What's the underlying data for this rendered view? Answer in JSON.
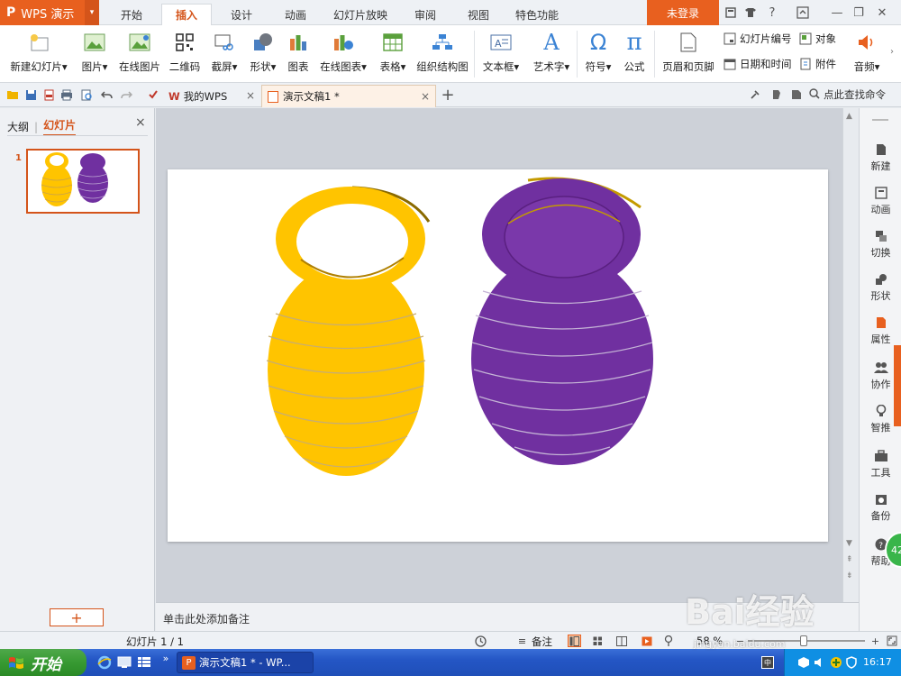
{
  "app": {
    "logo": "P",
    "name": "WPS 演示",
    "menu_arrow": "▾"
  },
  "ribbon_tabs": [
    {
      "label": "开始"
    },
    {
      "label": "插入"
    },
    {
      "label": "设计"
    },
    {
      "label": "动画"
    },
    {
      "label": "幻灯片放映"
    },
    {
      "label": "审阅"
    },
    {
      "label": "视图"
    },
    {
      "label": "特色功能"
    }
  ],
  "login": "未登录",
  "title_icons": {
    "help": "?",
    "minimize": "—",
    "restore": "❐",
    "close": "✕"
  },
  "ribbon": {
    "new_slide": "新建幻灯片",
    "picture": "图片",
    "online_picture": "在线图片",
    "qrcode": "二维码",
    "screenshot": "截屏",
    "shape": "形状",
    "chart": "图表",
    "online_chart": "在线图表",
    "table": "表格",
    "org_chart": "组织结构图",
    "textbox": "文本框",
    "wordart": "艺术字",
    "symbol": "符号",
    "formula": "公式",
    "header_footer": "页眉和页脚",
    "slide_number": "幻灯片编号",
    "object": "对象",
    "date_time": "日期和时间",
    "attachment": "附件",
    "audio": "音频",
    "dropdown": "▾",
    "symbol_glyph": "Ω",
    "formula_glyph": "π",
    "wordart_glyph": "A"
  },
  "doc_tabs": [
    {
      "label": "我的WPS",
      "close": "×"
    },
    {
      "label": "演示文稿1 *",
      "close": "×"
    }
  ],
  "new_tab": "+",
  "find_command": "点此查找命令",
  "pane": {
    "outline": "大纲",
    "slides": "幻灯片",
    "close": "×",
    "slide_number": "1",
    "add": "+"
  },
  "notes_placeholder": "单击此处添加备注",
  "right_sidebar": [
    {
      "label": "新建"
    },
    {
      "label": "动画"
    },
    {
      "label": "切换"
    },
    {
      "label": "形状"
    },
    {
      "label": "属性"
    },
    {
      "label": "协作"
    },
    {
      "label": "智推"
    },
    {
      "label": "工具"
    },
    {
      "label": "备份"
    },
    {
      "label": "帮助"
    }
  ],
  "badge": "42",
  "status": {
    "slide_label": "幻灯片 1 / 1",
    "notes": "备注",
    "zoom": "58 %",
    "zoom_minus": "−",
    "zoom_plus": "+",
    "zoom_level": 0.58
  },
  "taskbar": {
    "start": "开始",
    "task": "演示文稿1 * - WP...",
    "task_icon": "P",
    "lang": "中",
    "clock": "16:17",
    "expand": "»"
  },
  "watermark": {
    "brand": "Bai经验",
    "url": "jingyan.baidu.com"
  },
  "colors": {
    "accent": "#e8601f",
    "jar_yellow": "#ffc400",
    "jar_purple": "#7030a0"
  }
}
